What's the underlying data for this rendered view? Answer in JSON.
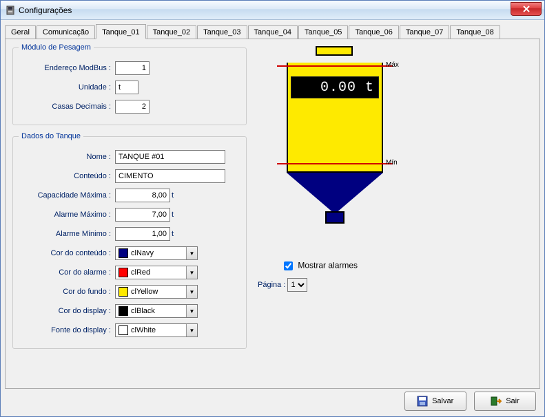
{
  "window": {
    "title": "Configurações"
  },
  "tabs": {
    "items": [
      "Geral",
      "Comunicação",
      "Tanque_01",
      "Tanque_02",
      "Tanque_03",
      "Tanque_04",
      "Tanque_05",
      "Tanque_06",
      "Tanque_07",
      "Tanque_08"
    ],
    "active_index": 2
  },
  "weighing": {
    "legend": "Módulo de Pesagem",
    "address_label": "Endereço ModBus :",
    "address_value": "1",
    "unit_label": "Unidade :",
    "unit_value": "t",
    "decimals_label": "Casas Decimais :",
    "decimals_value": "2"
  },
  "tankdata": {
    "legend": "Dados do Tanque",
    "name_label": "Nome  :",
    "name_value": "TANQUE #01",
    "content_label": "Conteúdo :",
    "content_value": "CIMENTO",
    "capmax_label": "Capacidade Máxima :",
    "capmax_value": "8,00",
    "capmax_unit": "t",
    "almmax_label": "Alarme Máximo :",
    "almmax_value": "7,00",
    "almmax_unit": "t",
    "almmin_label": "Alarme Mínimo :",
    "almmin_value": "1,00",
    "almmin_unit": "t",
    "colorcontent_label": "Cor do conteúdo :",
    "colorcontent_value": "clNavy",
    "colorcontent_hex": "#000080",
    "coloralarm_label": "Cor do alarme :",
    "coloralarm_value": "clRed",
    "coloralarm_hex": "#ff0000",
    "colorback_label": "Cor do fundo :",
    "colorback_value": "clYellow",
    "colorback_hex": "#feea00",
    "colordisplay_label": "Cor do display :",
    "colordisplay_value": "clBlack",
    "colordisplay_hex": "#000000",
    "fontdisplay_label": "Fonte do display :",
    "fontdisplay_value": "clWhite",
    "fontdisplay_hex": "#ffffff"
  },
  "preview": {
    "display_value": "0.00 t",
    "max_label": "Máx",
    "min_label": "Mín",
    "show_alarms_label": "Mostrar alarmes",
    "show_alarms_checked": true,
    "page_label": "Página :",
    "page_value": "1"
  },
  "buttons": {
    "save": "Salvar",
    "exit": "Sair"
  }
}
